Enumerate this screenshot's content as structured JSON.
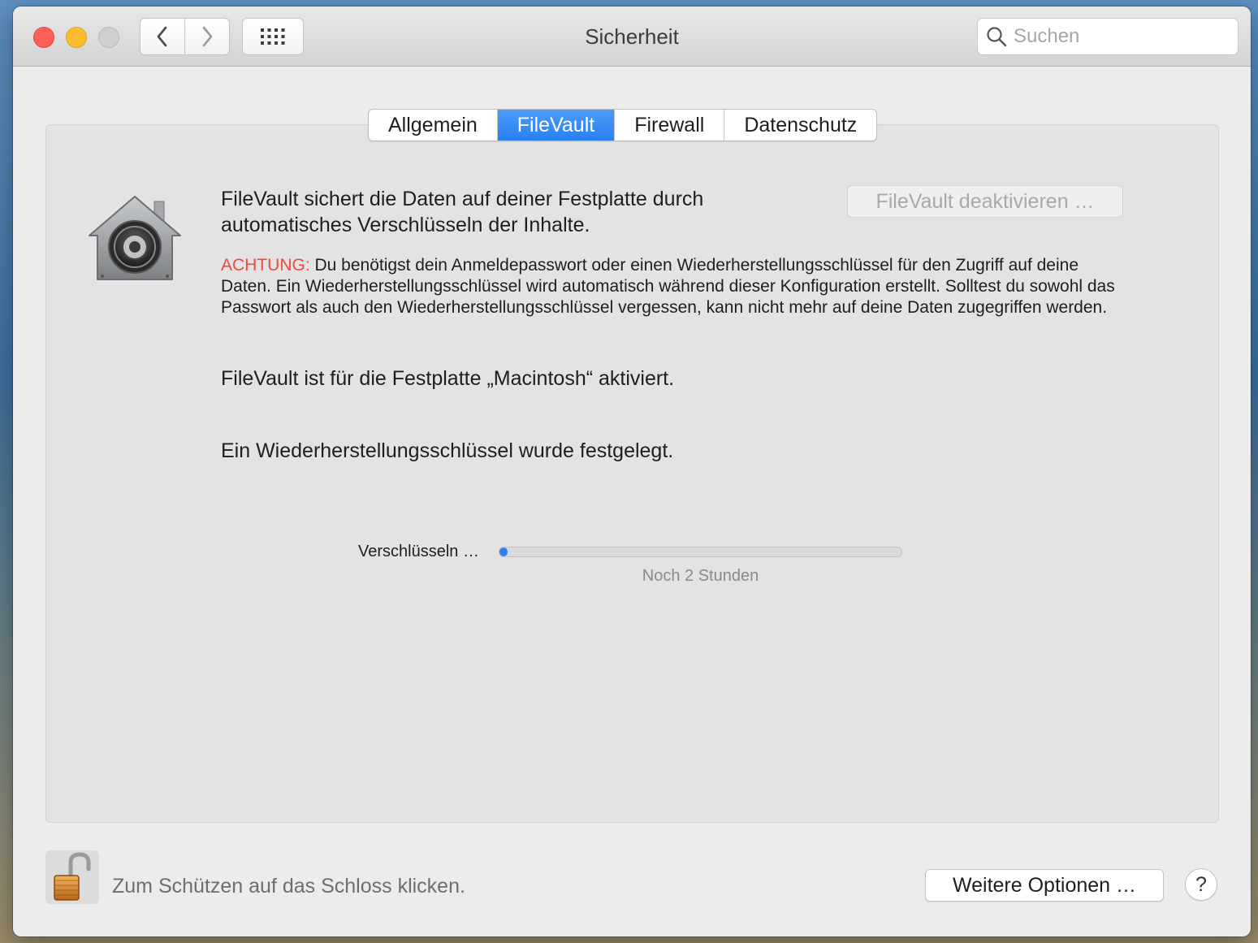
{
  "window": {
    "title": "Sicherheit"
  },
  "search": {
    "placeholder": "Suchen"
  },
  "tabs": [
    {
      "label": "Allgemein",
      "active": false
    },
    {
      "label": "FileVault",
      "active": true
    },
    {
      "label": "Firewall",
      "active": false
    },
    {
      "label": "Datenschutz",
      "active": false
    }
  ],
  "filevault": {
    "intro": "FileVault sichert die Daten auf deiner Festplatte durch automatisches Verschlüsseln der Inhalte.",
    "deactivate_button": "FileVault deaktivieren …",
    "warning_label": "ACHTUNG:",
    "warning_text": " Du benötigst dein Anmeldepasswort oder einen Wiederherstellungsschlüssel für den Zugriff auf deine Daten. Ein Wiederherstellungsschlüssel wird automatisch während dieser Konfiguration erstellt. Solltest du sowohl das Passwort als auch den Wiederherstellungsschlüssel vergessen, kann nicht mehr auf deine Daten zugegriffen werden.",
    "status_enabled": "FileVault ist für die Festplatte „Macintosh“ aktiviert.",
    "status_key": "Ein Wiederherstellungsschlüssel wurde festgelegt.",
    "encrypting_label": "Verschlüsseln …",
    "progress_fraction": 0.02,
    "remaining_text": "Noch 2 Stunden"
  },
  "footer": {
    "lock_text": "Zum Schützen auf das Schloss klicken.",
    "more_options_button": "Weitere Optionen …",
    "help_button": "?"
  },
  "colors": {
    "accent": "#2f7ff0",
    "warning": "#f04a3e"
  },
  "icons": {
    "filevault": "filevault-house-vault-icon",
    "lock": "unlocked-padlock-icon",
    "search": "magnifier-icon",
    "back": "chevron-left-icon",
    "forward": "chevron-right-icon",
    "grid": "grid-dots-icon"
  }
}
